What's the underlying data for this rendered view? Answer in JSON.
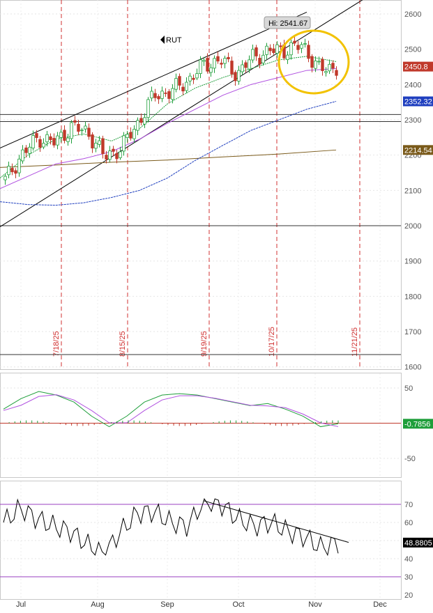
{
  "symbol": {
    "label": "RUT",
    "icon": "caret-left-icon"
  },
  "hi_label": "Hi: 2541.67",
  "date_markers": [
    "7/18/25",
    "8/15/25",
    "9/19/25",
    "10/17/25",
    "11/21/25"
  ],
  "months": [
    "Jul",
    "Aug",
    "Sep",
    "Oct",
    "Nov",
    "Dec"
  ],
  "price_axis": {
    "ticks": [
      "2600",
      "2500",
      "2400",
      "2300",
      "2200",
      "2100",
      "2000",
      "1900",
      "1800",
      "1700",
      "1600"
    ]
  },
  "price_badges": {
    "last": {
      "text": "2450.8",
      "color": "#c0392b"
    },
    "ma_short": {
      "text": "2352.32",
      "color": "#1f3fbf"
    },
    "ma_long": {
      "text": "2214.54",
      "color": "#7a5a1a"
    }
  },
  "macd_axis": {
    "ticks": [
      "50",
      "-50"
    ]
  },
  "macd_badge": {
    "text": "-0.7856",
    "color": "#1e9e3a"
  },
  "rsi_axis": {
    "ticks": [
      "70",
      "60",
      "50",
      "40",
      "30",
      "20"
    ]
  },
  "rsi_badge": {
    "text": "48.8805",
    "color": "#000000"
  },
  "colors": {
    "up": "#1e9e3a",
    "down": "#c0392b",
    "ma20": "#1e9e3a",
    "ma50": "#b050e0",
    "ma100": "#1f3fbf",
    "ma200": "#7a5a1a",
    "highlight_circle": "#f2c200",
    "marker_line": "#d03030",
    "rsi_band": "#9a3fc0"
  },
  "chart_data": [
    {
      "type": "candlestick",
      "title": "RUT",
      "x_range": [
        "2025-06-25",
        "2025-12-15"
      ],
      "ylim": [
        1580,
        2620
      ],
      "annotation": "Hi: 2541.67",
      "horizontal_levels": [
        2315,
        2295,
        2000,
        1635
      ],
      "series": [
        {
          "name": "close",
          "dates": [
            "2025-06-25",
            "2025-07-01",
            "2025-07-08",
            "2025-07-15",
            "2025-07-22",
            "2025-07-29",
            "2025-08-05",
            "2025-08-12",
            "2025-08-19",
            "2025-08-26",
            "2025-09-02",
            "2025-09-09",
            "2025-09-16",
            "2025-09-23",
            "2025-09-30",
            "2025-10-07",
            "2025-10-14",
            "2025-10-21",
            "2025-10-28",
            "2025-11-04",
            "2025-11-11"
          ],
          "values": [
            2130,
            2200,
            2250,
            2235,
            2280,
            2265,
            2195,
            2220,
            2290,
            2370,
            2380,
            2410,
            2455,
            2470,
            2430,
            2480,
            2495,
            2500,
            2510,
            2440,
            2450.8
          ]
        }
      ]
    },
    {
      "type": "line",
      "title": "MACD",
      "ylim": [
        -75,
        60
      ],
      "series": [
        {
          "name": "macd",
          "values": [
            20,
            35,
            45,
            40,
            30,
            10,
            -5,
            10,
            30,
            40,
            42,
            40,
            35,
            30,
            25,
            28,
            20,
            10,
            -5,
            -0.7856
          ]
        }
      ]
    },
    {
      "type": "line",
      "title": "RSI",
      "ylim": [
        20,
        75
      ],
      "series": [
        {
          "name": "rsi",
          "values": [
            60,
            68,
            62,
            58,
            55,
            48,
            42,
            55,
            65,
            66,
            60,
            58,
            72,
            70,
            62,
            58,
            60,
            55,
            52,
            46,
            48.8805
          ]
        }
      ]
    }
  ]
}
